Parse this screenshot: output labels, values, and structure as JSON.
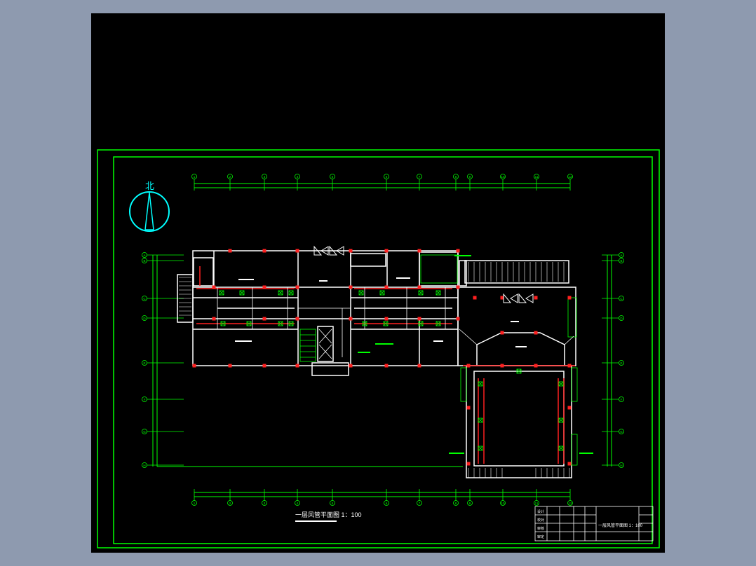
{
  "north_label": "北",
  "drawing_title": "一层风管平面图 1：100",
  "title_block": {
    "sheet_name": "一层风管平面图 1：100",
    "left_labels": [
      "设计",
      "校对",
      "审核",
      "审定"
    ]
  },
  "grid_top": [
    "1",
    "2",
    "3",
    "4",
    "5",
    "6",
    "7",
    "8",
    "9",
    "10",
    "11",
    "12"
  ],
  "grid_bottom": [
    "1",
    "2",
    "3",
    "4",
    "5",
    "6",
    "7",
    "8",
    "9",
    "10",
    "11",
    "12"
  ],
  "grid_left": [
    "A",
    "B",
    "C",
    "D",
    "E",
    "F",
    "G",
    "H"
  ],
  "grid_right": [
    "A",
    "B",
    "C",
    "D",
    "E",
    "F",
    "G",
    "H"
  ],
  "colors": {
    "frame": "#00ff00",
    "wall": "#ffffff",
    "duct": "#ff2020",
    "dimension": "#00ff00",
    "north": "#00ffff",
    "background": "#000000"
  }
}
